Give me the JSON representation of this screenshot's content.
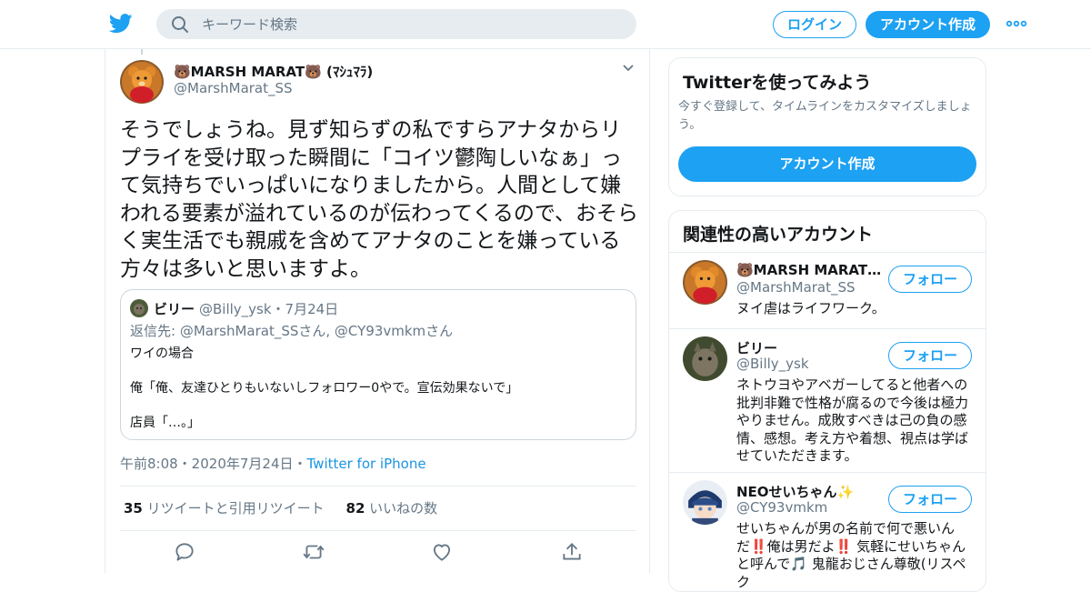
{
  "header": {
    "search_placeholder": "キーワード検索",
    "login_label": "ログイン",
    "signup_label": "アカウント作成",
    "brand_color": "#1da1f2"
  },
  "tweet": {
    "author_name": "🐻MARSH MARAT🐻 (ﾏｼｭﾏﾗ)",
    "author_handle": "@MarshMarat_SS",
    "text": "そうでしょうね。見ず知らずの私ですらアナタからリプライを受け取った瞬間に「コイツ鬱陶しいなぁ」って気持ちでいっぱいになりましたから。人間として嫌われる要素が溢れているのが伝わってくるので、おそらく実生活でも親戚を含めてアナタのことを嫌っている方々は多いと思いますよ。",
    "quoted": {
      "name": "ビリー",
      "handle_date": "@Billy_ysk・7月24日",
      "reply_prefix": "返信先: ",
      "reply_to": "@MarshMarat_SSさん, @CY93vmkmさん",
      "line1": "ワイの場合",
      "line2": "俺「俺、友達ひとりもいないしフォロワー0やで。宣伝効果ないで」",
      "line3": "店員「…。」"
    },
    "time": "午前8:08・2020年7月24日・",
    "source": "Twitter for iPhone",
    "retweets_count": "35",
    "retweets_label": "リツイートと引用リツイート",
    "likes_count": "82",
    "likes_label": "いいねの数"
  },
  "sidebar": {
    "signup_card": {
      "title": "Twitterを使ってみよう",
      "subtitle": "今すぐ登録して、タイムラインをカスタマイズしましょう。",
      "button": "アカウント作成"
    },
    "related": {
      "title": "関連性の高いアカウント",
      "follow_label": "フォロー",
      "accounts": [
        {
          "name": "🐻MARSH MARAT…",
          "handle": "@MarshMarat_SS",
          "bio": "ヌイ虐はライフワーク。"
        },
        {
          "name": "ビリー",
          "handle": "@Billy_ysk",
          "bio": "ネトウヨやアベガーしてると他者への批判非難で性格が腐るので今後は極力やりません。成敗すべきは己の負の感情、感想。考え方や着想、視点は学ばせていただきます。"
        },
        {
          "name": "NEOせいちゃん✨",
          "handle": "@CY93vmkm",
          "bio": "せいちゃんが男の名前で何で悪いんだ‼️俺は男だよ‼️ 気軽にせいちゃんと呼んで🎵 鬼龍おじさん尊敬(リスペク"
        }
      ]
    }
  }
}
